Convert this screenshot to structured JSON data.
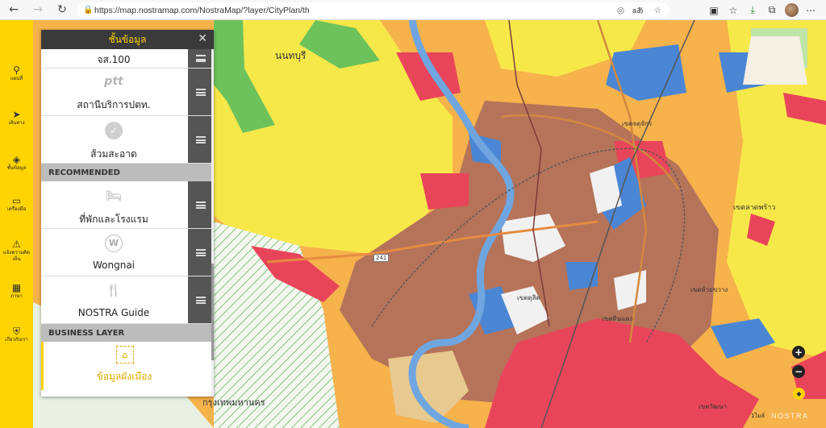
{
  "browser": {
    "url": "https://map.nostramap.com/NostraMap/?layer/CityPlan/th",
    "reader_label": "aあ"
  },
  "rail": {
    "items": [
      {
        "label": "แผนที่",
        "icon": "map-pin-icon"
      },
      {
        "label": "เส้นทาง",
        "icon": "navigation-arrow-icon"
      },
      {
        "label": "ชั้นข้อมูล",
        "icon": "layers-icon"
      },
      {
        "label": "เครื่องมือ",
        "icon": "tools-icon"
      },
      {
        "label": "แจ้งความคิดเห็น",
        "icon": "feedback-icon"
      },
      {
        "label": "ภาษา",
        "icon": "language-icon"
      },
      {
        "label": "เกี่ยวกับเรา",
        "icon": "about-shield-icon"
      }
    ]
  },
  "panel": {
    "title": "ชั้นข้อมูล",
    "rows_top": [
      {
        "label": "จส.100",
        "icon": ""
      },
      {
        "label": "สถานีบริการปตท.",
        "icon": "ptt"
      },
      {
        "label": "ส้วมสะอาด",
        "icon": "toilet-icon"
      }
    ],
    "recommended_header": "RECOMMENDED",
    "rows_recommended": [
      {
        "label": "ที่พักและโรงแรม",
        "icon": "bed-icon"
      },
      {
        "label": "Wongnai",
        "icon": "W"
      },
      {
        "label": "NOSTRA Guide",
        "icon": "fork-knife-icon"
      }
    ],
    "business_header": "BUSINESS LAYER",
    "business_item": {
      "label": "ข้อมูลผังเมือง",
      "icon": "city-plan-icon"
    }
  },
  "map": {
    "labels": {
      "nonthaburi": "นนทบุรี",
      "district1": "เขตจตุจักร",
      "district2": "เขตลาดพร้าว",
      "district3": "เขตห้วยขวาง",
      "district4": "เขตดุสิต",
      "district5": "เขตดินแดง",
      "district6": "เขตวัฒนา",
      "bangkok": "กรุงเทพมหานคร",
      "route": "241"
    },
    "zoom_in": "+",
    "zoom_out": "−",
    "scale": "1ไมล์",
    "brand": "NOSTRA"
  },
  "colors": {
    "rail": "#ffd400",
    "panel_header": "#3a3a3a",
    "residential_low": "#f7e84a",
    "residential_mid": "#f6b24b",
    "residential_high": "#b5735a",
    "commercial": "#e9455a",
    "government": "#4b86d4",
    "agriculture": "#6dc25c",
    "river": "#6fa6e0"
  }
}
